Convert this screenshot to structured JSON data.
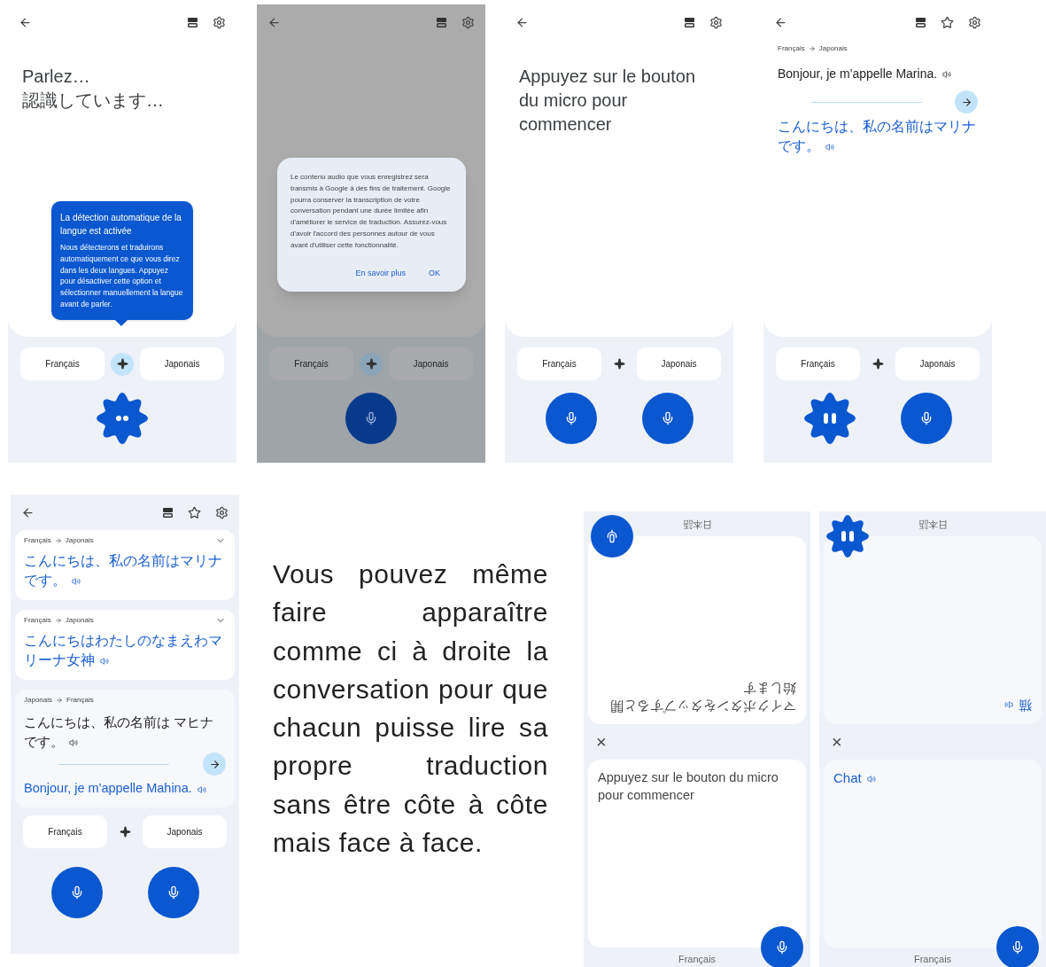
{
  "top_screens": [
    {
      "kind": "listening",
      "show_star": false,
      "dimmed": false,
      "prompt": [
        "Parlez…",
        "認識しています…"
      ],
      "tooltip": {
        "title": "La détection automatique de la langue est activée",
        "body": "Nous détecterons et traduirons automatiquement ce que vous direz dans les deux langues. Appuyez pour désactiver cette option et sélectionner manuellement la langue avant de parler."
      },
      "languages": [
        "Français",
        "Japonais"
      ],
      "auto_detect": true,
      "mics": [
        {
          "kind": "dots"
        }
      ]
    },
    {
      "kind": "consent",
      "show_star": false,
      "dimmed": true,
      "dialog": {
        "text": "Le contenu audio que vous enregistrez sera transmis à Google à des fins de traitement. Google pourra conserver la transcription de votre conversation pendant une durée limitée afin d'améliorer le service de traduction. Assurez-vous d'avoir l'accord des personnes autour de vous avant d'utiliser cette fonctionnalité.",
        "actions": [
          "En savoir plus",
          "OK"
        ]
      },
      "languages": [
        "Français",
        "Japonais"
      ],
      "auto_detect": true,
      "mics": [
        {
          "kind": "mic"
        }
      ]
    },
    {
      "kind": "prompt",
      "show_star": false,
      "dimmed": false,
      "prompt": [
        "Appuyez sur le bouton du micro pour commencer"
      ],
      "languages": [
        "Français",
        "Japonais"
      ],
      "auto_detect": false,
      "mics": [
        {
          "kind": "mic"
        },
        {
          "kind": "mic"
        }
      ]
    },
    {
      "kind": "result",
      "show_star": true,
      "dimmed": false,
      "result": {
        "from": "Français",
        "to": "Japonais",
        "source": "Bonjour, je m'appelle Marina.",
        "translation": "こんにちは、私の名前はマリナです。"
      },
      "languages": [
        "Français",
        "Japonais"
      ],
      "auto_detect": false,
      "mics": [
        {
          "kind": "bars"
        },
        {
          "kind": "mic"
        }
      ]
    }
  ],
  "history_screen": {
    "show_star": true,
    "cards": [
      {
        "from": "Français",
        "to": "Japonais",
        "translation": "こんにちは、私の名前はマリナです。",
        "collapsible": true
      },
      {
        "from": "Français",
        "to": "Japonais",
        "translation": "こんにちはわたしのなまえわマリーナ女神",
        "collapsible": true
      },
      {
        "from": "Japonais",
        "to": "Français",
        "source": "こんにちは、私の名前は マヒナです。",
        "translation": "Bonjour, je m'appelle Mahina.",
        "collapsible": false
      }
    ],
    "languages": [
      "Français",
      "Japonais"
    ],
    "auto_detect": false,
    "mics": [
      {
        "kind": "mic"
      },
      {
        "kind": "mic"
      }
    ]
  },
  "caption": "Vous pouvez même faire apparaître comme ci à droite la conversation pour que chacun puisse lire sa propre traduction sans être côte à côte mais face à face.",
  "face_to_face": [
    {
      "top": {
        "language": "日本語",
        "text": "マイクボタンをタップすると開始します",
        "kind": "prompt",
        "mic": {
          "kind": "mic"
        }
      },
      "close": "×",
      "bottom": {
        "language": "Français",
        "text": "Appuyez sur le bouton du micro pour commencer",
        "kind": "prompt",
        "mic": {
          "kind": "mic"
        }
      }
    },
    {
      "top": {
        "language": "日本語",
        "text": "猫",
        "kind": "translation",
        "mic": {
          "kind": "bars"
        }
      },
      "close": "×",
      "bottom": {
        "language": "Français",
        "text": "Chat",
        "kind": "translation",
        "mic": {
          "kind": "mic"
        }
      }
    }
  ]
}
